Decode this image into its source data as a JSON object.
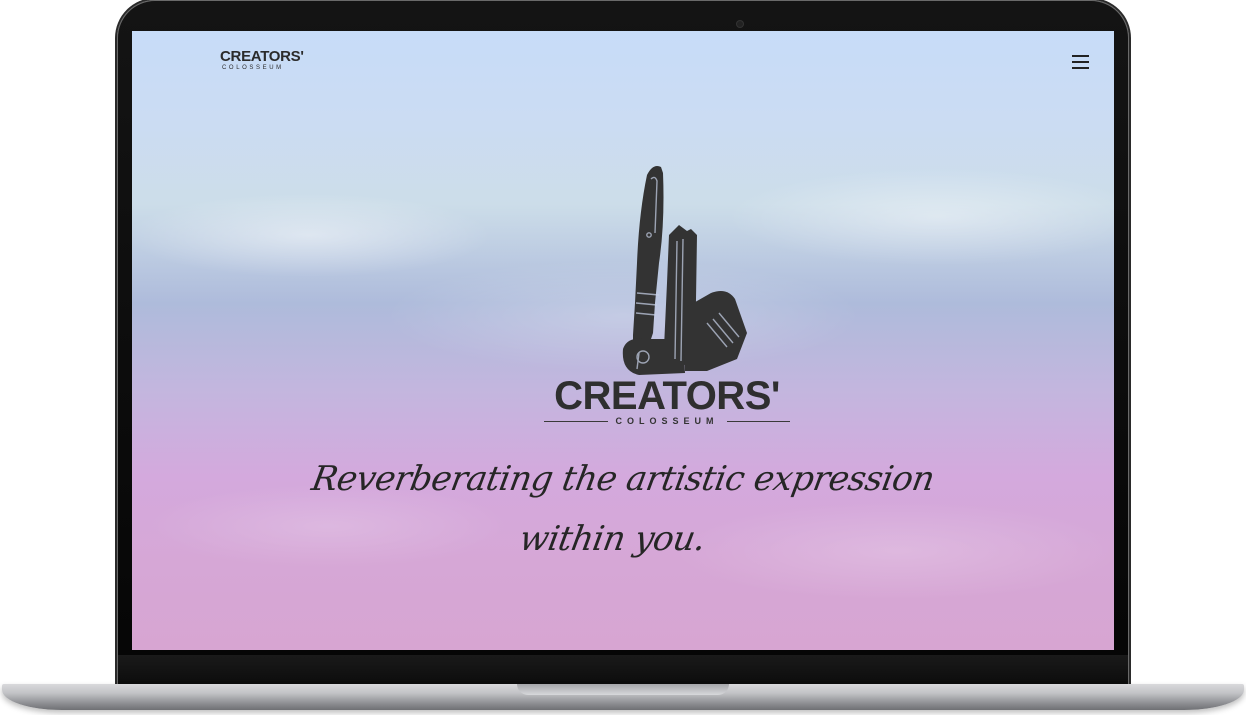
{
  "header": {
    "logo_main": "CREATORS'",
    "logo_sub": "COLOSSEUM",
    "menu_icon": "hamburger-menu-icon"
  },
  "hero": {
    "title": "CREATORS'",
    "subtitle": "COLOSSEUM",
    "emblem_icon": "fountain-pen-and-column-icon",
    "tagline": "Reverberating the artistic expression within you."
  },
  "colors": {
    "logo_text": "#2f2f2f",
    "sky_top": "#c7dcf8",
    "sky_bottom": "#d7a5d2"
  }
}
